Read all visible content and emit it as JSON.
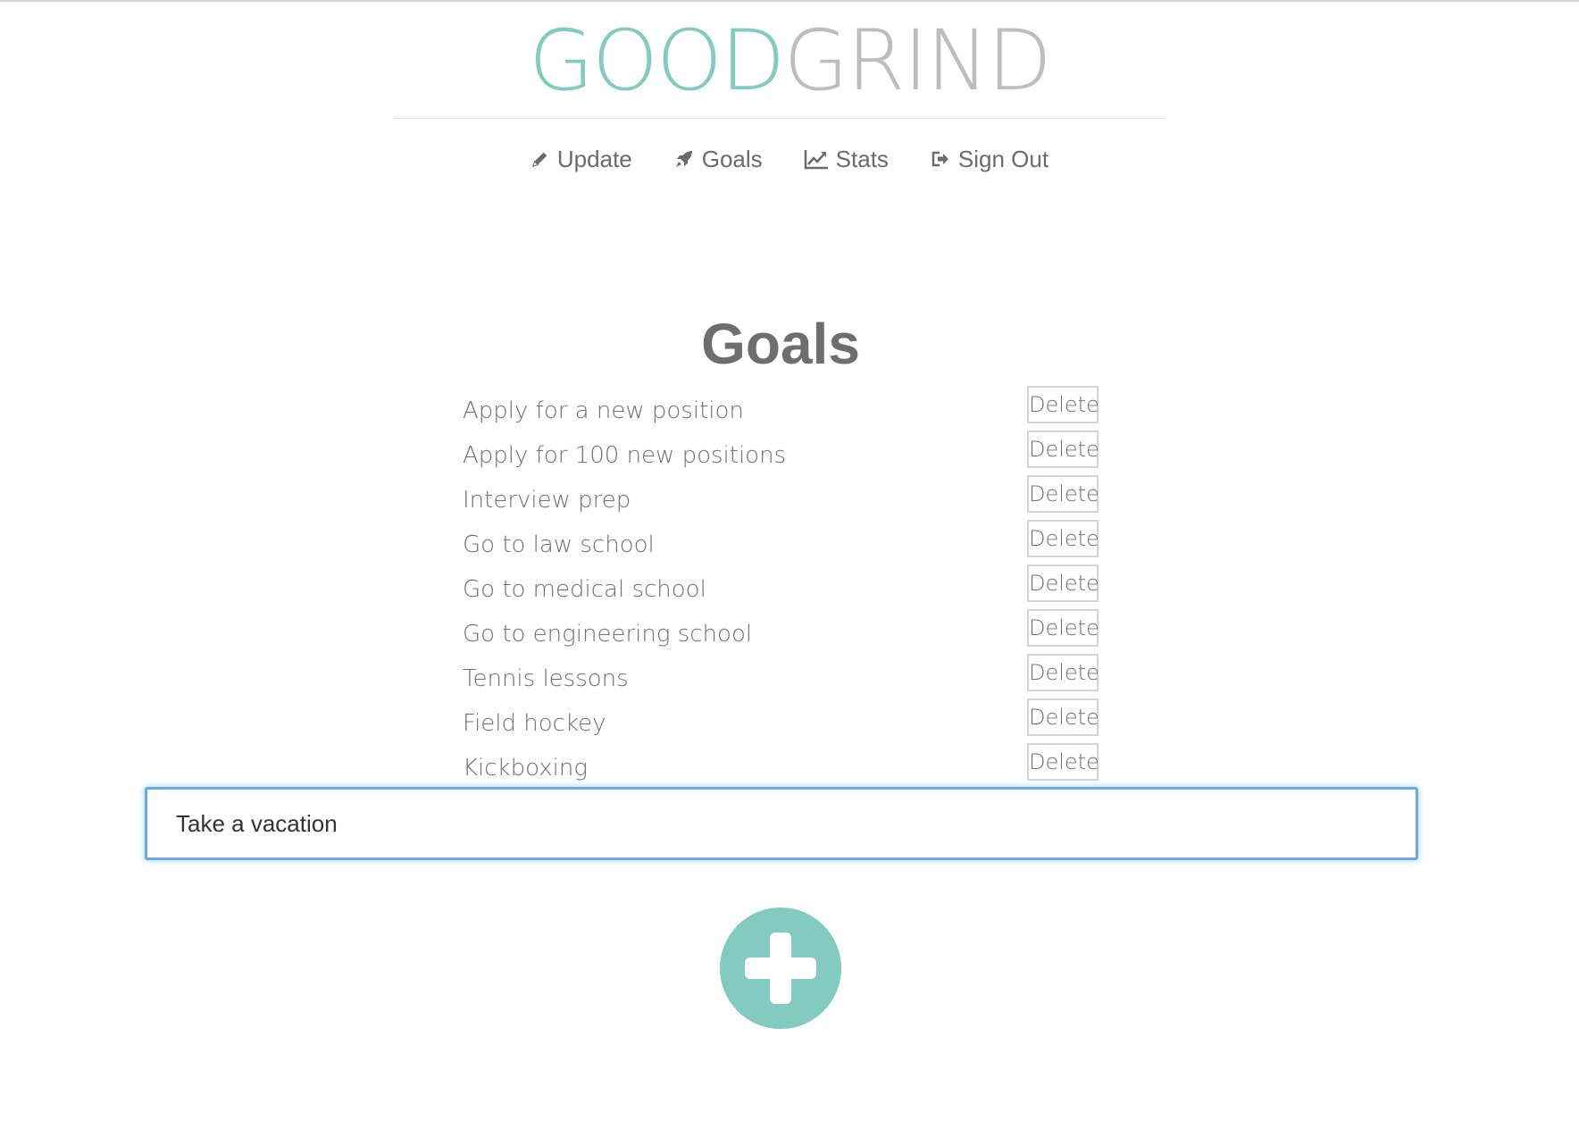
{
  "colors": {
    "accent": "#83cbc1",
    "muted": "#bdbdbd",
    "input_focus": "#6aa8e6"
  },
  "logo": {
    "part1": "GOOD",
    "part2": "GRIND"
  },
  "nav": [
    {
      "label": "Update",
      "icon": "pencil-icon"
    },
    {
      "label": "Goals",
      "icon": "rocket-icon"
    },
    {
      "label": "Stats",
      "icon": "line-chart-icon"
    },
    {
      "label": "Sign Out",
      "icon": "sign-out-icon"
    }
  ],
  "page_title": "Goals",
  "goals": [
    {
      "label": "Apply for a new position",
      "action": "Delete"
    },
    {
      "label": "Apply for 100 new positions",
      "action": "Delete"
    },
    {
      "label": "Interview prep",
      "action": "Delete"
    },
    {
      "label": "Go to law school",
      "action": "Delete"
    },
    {
      "label": "Go to medical school",
      "action": "Delete"
    },
    {
      "label": "Go to engineering school",
      "action": "Delete"
    },
    {
      "label": "Tennis lessons",
      "action": "Delete"
    },
    {
      "label": "Field hockey",
      "action": "Delete"
    },
    {
      "label": "Kickboxing",
      "action": "Delete"
    }
  ],
  "new_goal_input": {
    "value": "Take a vacation"
  },
  "add_button": {
    "icon": "plus-icon"
  }
}
